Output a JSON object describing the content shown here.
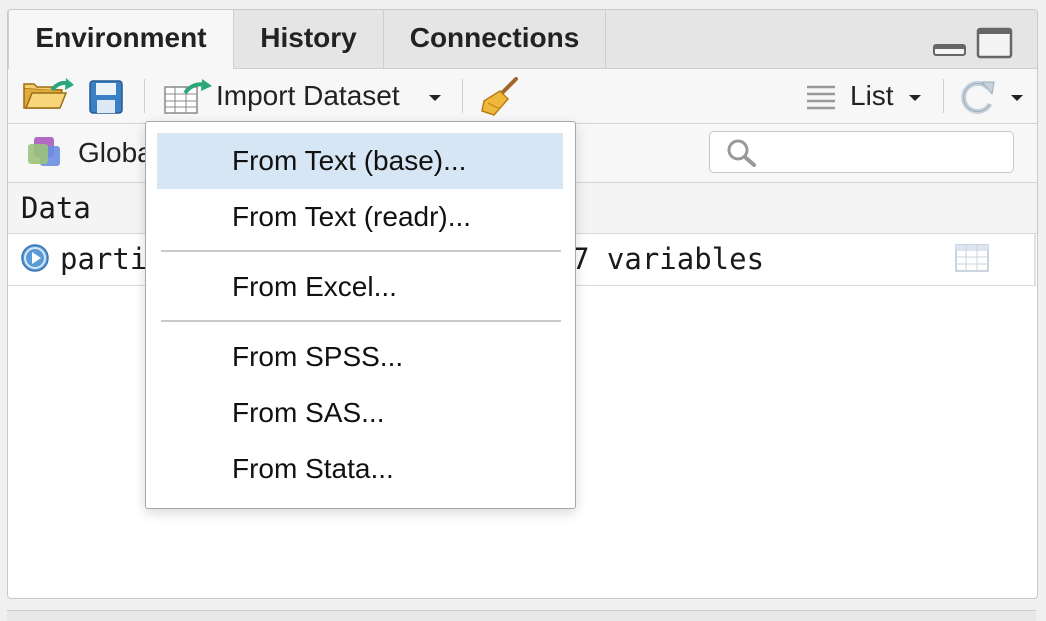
{
  "tabs": [
    {
      "label": "Environment"
    },
    {
      "label": "History"
    },
    {
      "label": "Connections"
    }
  ],
  "toolbar": {
    "import_label": "Import Dataset",
    "view_label": "List"
  },
  "environment": {
    "scope_label": "Global Environment"
  },
  "search": {
    "placeholder": ""
  },
  "section": {
    "header": "Data"
  },
  "row": {
    "name_visible": "parti",
    "summary_visible": "7 variables"
  },
  "menu": {
    "items": [
      {
        "label": "From Text (base)..."
      },
      {
        "label": "From Text (readr)..."
      },
      {
        "label": "From Excel..."
      },
      {
        "label": "From SPSS..."
      },
      {
        "label": "From SAS..."
      },
      {
        "label": "From Stata..."
      }
    ]
  },
  "colors": {
    "highlight": "#d7e6f4",
    "accent_green": "#2aa87a",
    "save_blue": "#3b7fc4"
  },
  "icons": [
    "open-folder-icon",
    "save-icon",
    "import-table-icon",
    "broom-icon",
    "list-icon",
    "refresh-icon",
    "search-icon",
    "expand-icon",
    "grid-view-icon",
    "minimize-icon",
    "maximize-icon",
    "environment-icon"
  ]
}
